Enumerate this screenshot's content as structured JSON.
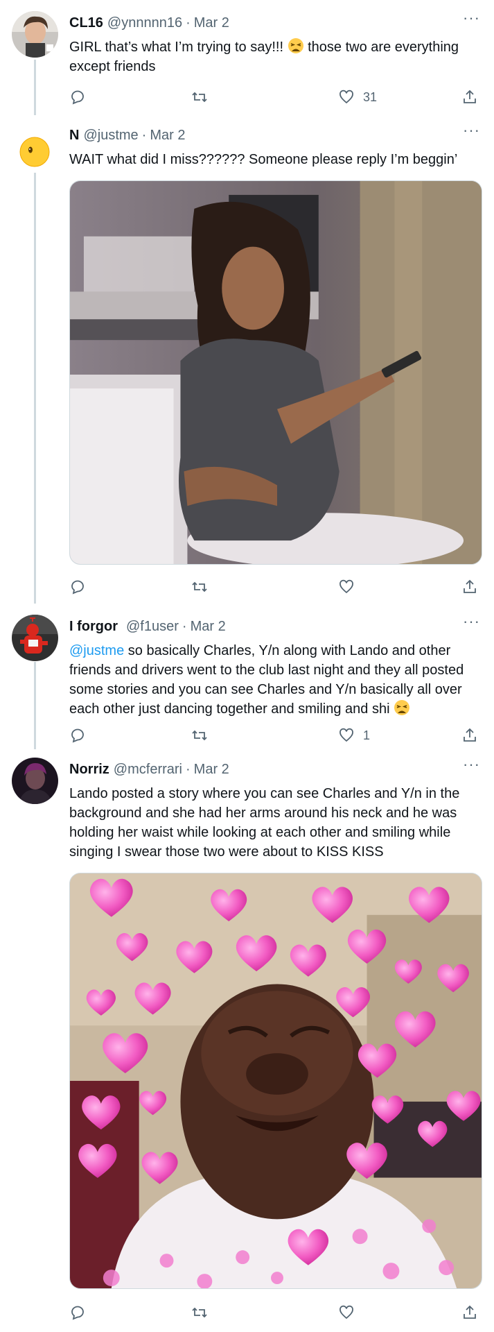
{
  "tweets": [
    {
      "name": "CL16",
      "handle": "@ynnnnn16",
      "separator": "·",
      "date": "Mar 2",
      "text": "GIRL that’s what I’m trying to say!!! ",
      "text_after_emoji": " those two are everything except friends",
      "emoji": "weary-face",
      "likes": "31",
      "more": "···"
    },
    {
      "name": "N",
      "handle": "@justme",
      "separator": "·",
      "date": "Mar 2",
      "text": "WAIT what did I miss?????? Someone please reply I’m beggin’",
      "media": "photo-girl-holding-phone",
      "likes": "",
      "more": "···"
    },
    {
      "name": "I forgor",
      "handle": "@f1user",
      "separator": "·",
      "date": "Mar 2",
      "mention": "@justme",
      "text": " so basically Charles, Y/n along with Lando and other friends and drivers went to the club last night and they all posted some stories and you can see Charles and Y/n basically all over each other just dancing together and smiling and shi ",
      "emoji": "weary-face",
      "likes": "1",
      "more": "···"
    },
    {
      "name": "Norriz",
      "handle": "@mcferrari",
      "separator": "·",
      "date": "Mar 2",
      "text": "Lando posted a story where you can see Charles and Y/n in the background and she had her arms around his neck and he was holding her waist while looking at each other and smiling while singing I swear those two were about to KISS KISS",
      "media": "photo-man-crying-with-hearts",
      "likes": "",
      "more": "···"
    }
  ],
  "icons": {
    "reply": "reply-icon",
    "retweet": "retweet-icon",
    "like": "heart-icon",
    "share": "share-icon"
  },
  "colors": {
    "text": "#0f1419",
    "secondary": "#536471",
    "link": "#1d9bf0",
    "thread_line": "#cfd9de"
  }
}
